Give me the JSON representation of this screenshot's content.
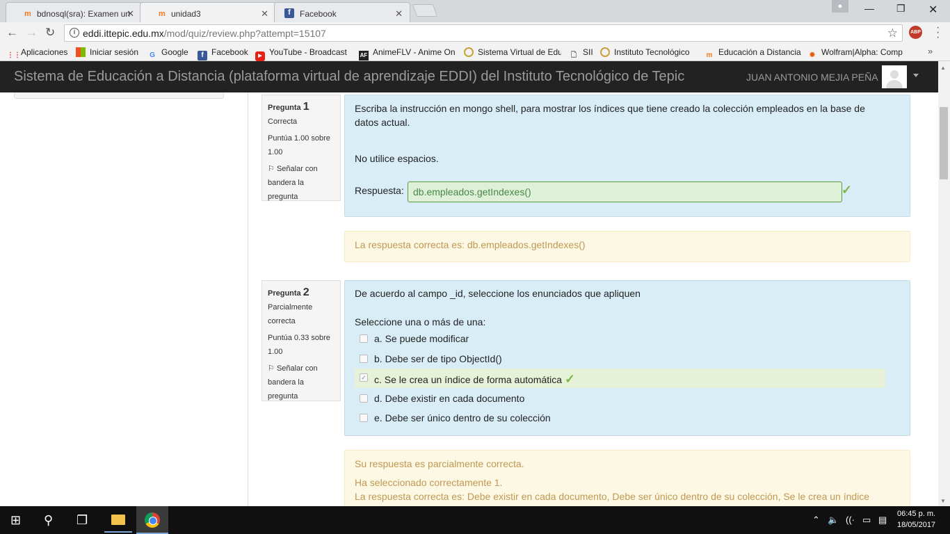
{
  "browser": {
    "tabs": [
      {
        "title": "bdnosql(sra): Examen un",
        "favicon": "moodle-icon"
      },
      {
        "title": "unidad3",
        "favicon": "moodle-icon"
      },
      {
        "title": "Facebook",
        "favicon": "facebook-icon"
      }
    ],
    "url_host": "eddi.ittepic.edu.mx",
    "url_path": "/mod/quiz/review.php?attempt=15107",
    "bookmarks": [
      "Aplicaciones",
      "Iniciar sesión",
      "Google",
      "Facebook",
      "YouTube - Broadcast",
      "AnimeFLV - Anime On",
      "Sistema Virtual de Edu",
      "SII",
      "Instituto Tecnológico",
      "Educación a Distancia",
      "Wolfram|Alpha: Comp"
    ]
  },
  "header": {
    "title": "Sistema de Educación a Distancia (plataforma virtual de aprendizaje EDDI) del Instituto Tecnológico de Tepic",
    "user_name": "JUAN ANTONIO MEJIA PEÑA"
  },
  "q1": {
    "label": "Pregunta",
    "number": "1",
    "state": "Correcta",
    "grade_line1": "Puntúa 1.00 sobre",
    "grade_line2": "1.00",
    "flag_line1": "Señalar con",
    "flag_line2": "bandera la pregunta",
    "text": "Escriba la instrucción en mongo shell, para mostrar los índices que tiene creado la colección empleados en la base de datos actual.",
    "note": "No utilice espacios.",
    "answer_label": "Respuesta:",
    "answer_value": "db.empleados.getIndexes()",
    "feedback": "La respuesta correcta es: db.empleados.getIndexes()"
  },
  "q2": {
    "label": "Pregunta",
    "number": "2",
    "state_line1": "Parcialmente",
    "state_line2": "correcta",
    "grade_line1": "Puntúa 0.33 sobre",
    "grade_line2": "1.00",
    "flag_line1": "Señalar con",
    "flag_line2": "bandera la pregunta",
    "text": "De acuerdo al campo _id, seleccione los enunciados que apliquen",
    "prompt": "Seleccione una o más de una:",
    "options": [
      {
        "label": "a. Se puede modificar",
        "checked": false
      },
      {
        "label": "b. Debe ser de tipo ObjectId()",
        "checked": false
      },
      {
        "label": "c. Se le crea un índice de forma automática",
        "checked": true
      },
      {
        "label": "d. Debe existir en cada documento",
        "checked": false
      },
      {
        "label": "e. Debe ser único dentro de su colección",
        "checked": false
      }
    ],
    "feedback1": "Su respuesta es parcialmente correcta.",
    "feedback2": "Ha seleccionado correctamente 1.",
    "feedback3": "La respuesta correcta es: Debe existir en cada documento, Debe ser único dentro de su colección, Se le crea un índice"
  },
  "taskbar": {
    "time": "06:45 p. m.",
    "date": "18/05/2017"
  }
}
